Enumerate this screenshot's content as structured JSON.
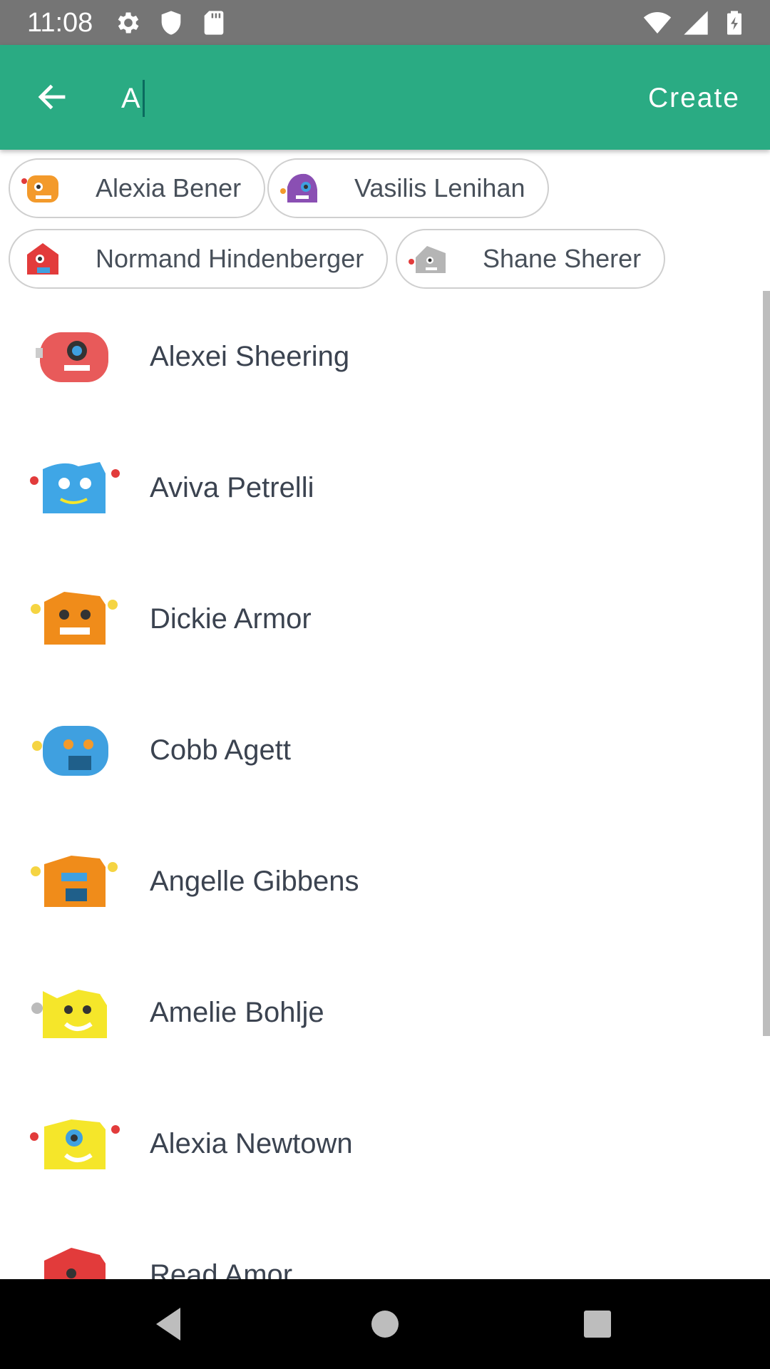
{
  "status_bar": {
    "time": "11:08",
    "left_icons": [
      "gear-icon",
      "shield-icon",
      "sd-card-icon"
    ],
    "right_icons": [
      "wifi-icon",
      "signal-icon",
      "battery-charging-icon"
    ]
  },
  "app_bar": {
    "background": "#2aab83",
    "search_value": "A",
    "create_label": "Create"
  },
  "selected_chips": [
    {
      "label": "Alexia Bener",
      "avatar_color": "#f39a2b"
    },
    {
      "label": "Vasilis Lenihan",
      "avatar_color": "#8a4fb3"
    },
    {
      "label": "Normand Hindenberger",
      "avatar_color": "#e23b3b"
    },
    {
      "label": "Shane Sherer",
      "avatar_color": "#b5b5b5"
    }
  ],
  "contacts": [
    {
      "name": "Alexei Sheering",
      "avatar_color": "#e85a5a"
    },
    {
      "name": "Aviva Petrelli",
      "avatar_color": "#3fa6e6"
    },
    {
      "name": "Dickie Armor",
      "avatar_color": "#f08c1a"
    },
    {
      "name": "Cobb Agett",
      "avatar_color": "#3fa0e0"
    },
    {
      "name": "Angelle Gibbens",
      "avatar_color": "#f08c1a"
    },
    {
      "name": "Amelie Bohlje",
      "avatar_color": "#f5e62a"
    },
    {
      "name": "Alexia Newtown",
      "avatar_color": "#f5e62a"
    },
    {
      "name": "Read Amor",
      "avatar_color": "#e23b3b"
    }
  ],
  "nav_bar": {
    "buttons": [
      "back-triangle-icon",
      "home-circle-icon",
      "recents-square-icon"
    ]
  }
}
